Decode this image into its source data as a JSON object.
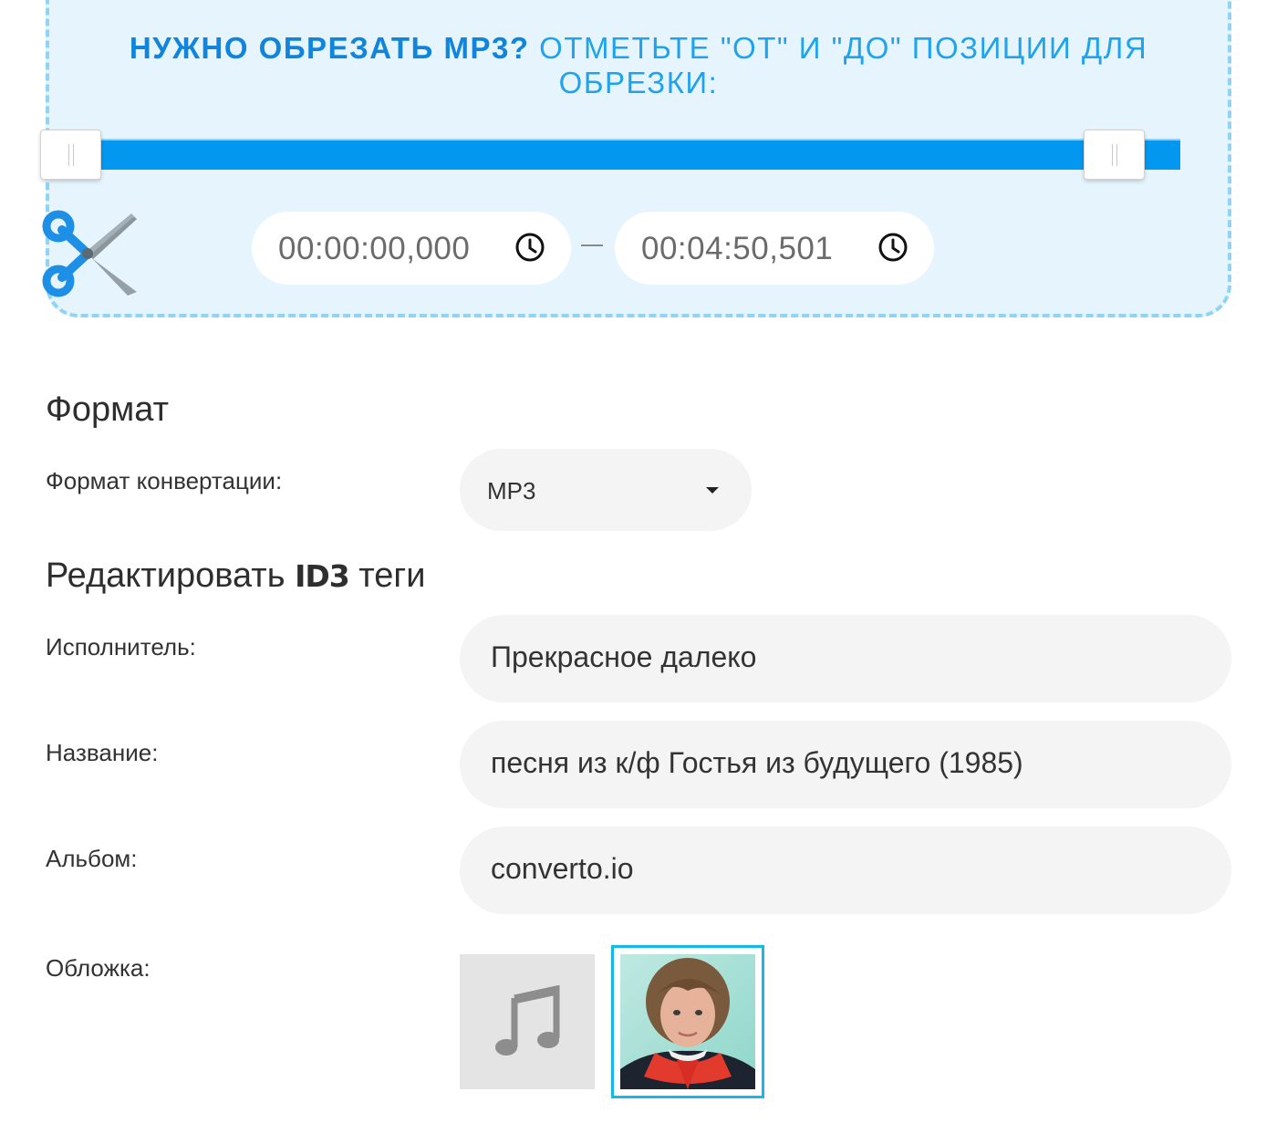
{
  "trim": {
    "title_strong": "НУЖНО ОБРЕЗАТЬ MP3?",
    "title_rest": "ОТМЕТЬТЕ \"ОТ\" И \"ДО\" ПОЗИЦИИ ДЛЯ ОБРЕЗКИ:",
    "range_start_fraction": 0.0,
    "range_end_fraction": 1.0,
    "from_time": "00:00:00,000",
    "to_time": "00:04:50,501",
    "accent_color": "#0397f0"
  },
  "format_section": {
    "title": "Формат",
    "label": "Формат конвертации:",
    "selected_value": "MP3"
  },
  "id3_section": {
    "title_before": "Редактировать",
    "title_bold": "ID3",
    "title_after": "теги",
    "fields": [
      {
        "label": "Исполнитель:",
        "value": "Прекрасное далеко"
      },
      {
        "label": "Название:",
        "value": "песня из к/ф Гостья из будущего (1985)"
      },
      {
        "label": "Альбом:",
        "value": "converto.io"
      }
    ],
    "cover_label": "Обложка:",
    "cover_options": [
      {
        "icon": "music-note-icon",
        "selected": false
      },
      {
        "icon": "cover-photo",
        "selected": true
      }
    ],
    "selected_border_color": "#14b8ec"
  }
}
